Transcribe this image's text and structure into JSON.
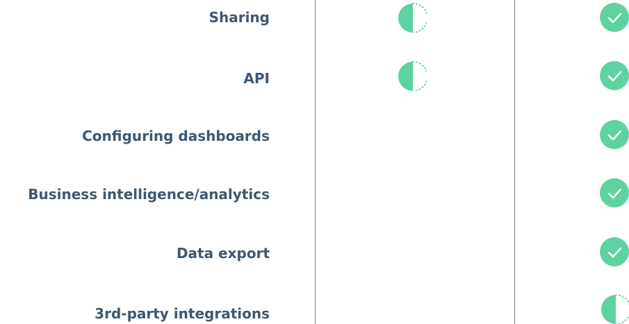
{
  "colors": {
    "accent": "#5ed3a0",
    "label": "#3f5870",
    "divider": "#6f7a86",
    "check": "#ffffff"
  },
  "features": [
    {
      "label": "Sharing",
      "col1": "partial",
      "col2": "full"
    },
    {
      "label": "API",
      "col1": "partial",
      "col2": "full"
    },
    {
      "label": "Configuring dashboards",
      "col1": "none",
      "col2": "full"
    },
    {
      "label": "Business intelligence/analytics",
      "col1": "none",
      "col2": "full"
    },
    {
      "label": "Data export",
      "col1": "none",
      "col2": "full"
    },
    {
      "label": "3rd-party integrations",
      "col1": "none",
      "col2": "partial"
    }
  ],
  "icons": {
    "full": "check-circle-icon",
    "partial": "half-circle-icon"
  }
}
